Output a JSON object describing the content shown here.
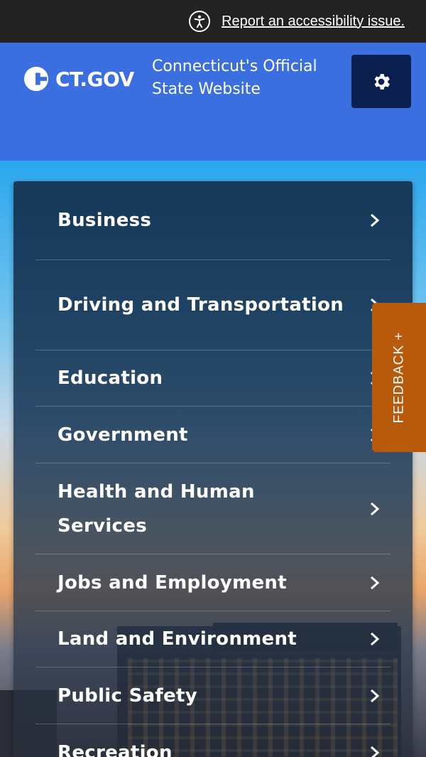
{
  "accessibility": {
    "link_text": "Report an accessibility issue.",
    "icon": "accessibility-icon"
  },
  "header": {
    "logo_text": "CT.GOV",
    "tagline": "Connecticut's Official State Website",
    "settings_icon": "gear-icon"
  },
  "menu": {
    "items": [
      {
        "label": "Business"
      },
      {
        "label": "Driving and Transportation"
      },
      {
        "label": "Education"
      },
      {
        "label": "Government"
      },
      {
        "label": "Health and Human Services"
      },
      {
        "label": "Jobs and Employment"
      },
      {
        "label": "Land and Environment"
      },
      {
        "label": "Public Safety"
      },
      {
        "label": "Recreation"
      }
    ]
  },
  "feedback": {
    "label": "FEEDBACK +"
  },
  "colors": {
    "topbar": "#222222",
    "header": "#3b6fe0",
    "settings_button": "#0a1f4d",
    "feedback": "#b85a0c"
  }
}
